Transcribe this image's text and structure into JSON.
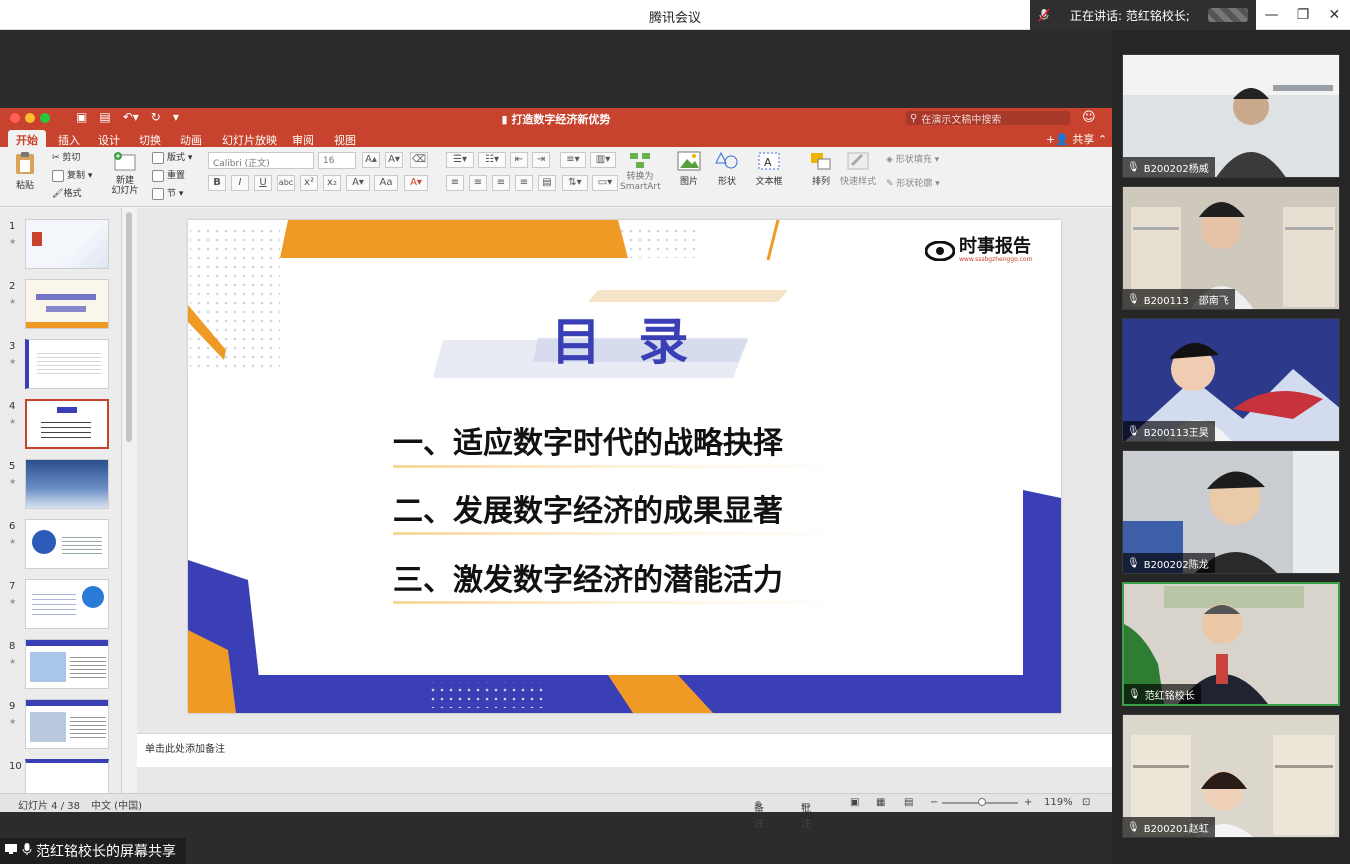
{
  "meeting": {
    "title": "腾讯会议",
    "speaking_label": "正在讲话: 范红铭校长;",
    "window_controls": [
      "—",
      "❐",
      "✕"
    ],
    "share_label": "范红铭校长的屏幕共享"
  },
  "ppt": {
    "doc_title": "打造数字经济新优势",
    "search_placeholder": "在演示文稿中搜索",
    "share_button": "共享",
    "tabs": [
      "开始",
      "插入",
      "设计",
      "切换",
      "动画",
      "幻灯片放映",
      "审阅",
      "视图"
    ],
    "active_tab": "开始",
    "ribbon": {
      "paste": "粘贴",
      "cut": "剪切",
      "copy": "复制",
      "format": "格式",
      "new_slide": "新建\n幻灯片",
      "layout": "版式",
      "reset": "重置",
      "section": "节",
      "font_name": "Calibri (正文)",
      "font_size": "16",
      "smartart": "转换为\nSmartArt",
      "picture": "图片",
      "shape": "形状",
      "textbox": "文本框",
      "arrange": "排列",
      "quick_styles": "快速样式",
      "shape_fill": "形状填充",
      "shape_outline": "形状轮廓"
    },
    "thumbnails": [
      "1",
      "2",
      "3",
      "4",
      "5",
      "6",
      "7",
      "8",
      "9",
      "10"
    ],
    "selected_thumbnail": 4,
    "slide": {
      "heading": "目 录",
      "logo_text": "时事报告",
      "logo_url": "www.sssbgzhenggo.com",
      "items": [
        "一、适应数字时代的战略抉择",
        "二、发展数字经济的成果显著",
        "三、激发数字经济的潜能活力"
      ]
    },
    "notes_placeholder": "单击此处添加备注",
    "status": {
      "slide_count": "幻灯片 4 / 38",
      "language": "中文 (中国)",
      "notes": "备注",
      "comments": "批注",
      "zoom": "119%"
    },
    "colors": {
      "accent": "#c8432d",
      "slide_blue": "#3a3fb6",
      "slide_orange": "#f09a26"
    }
  },
  "participants": [
    {
      "name": "B200202杨威",
      "active": false
    },
    {
      "name": "B200113　邵南飞",
      "active": false
    },
    {
      "name": "B200113王昊",
      "active": false
    },
    {
      "name": "B200202陈龙",
      "active": false
    },
    {
      "name": "范红铭校长",
      "active": true
    },
    {
      "name": "B200201赵虹",
      "active": false
    }
  ]
}
